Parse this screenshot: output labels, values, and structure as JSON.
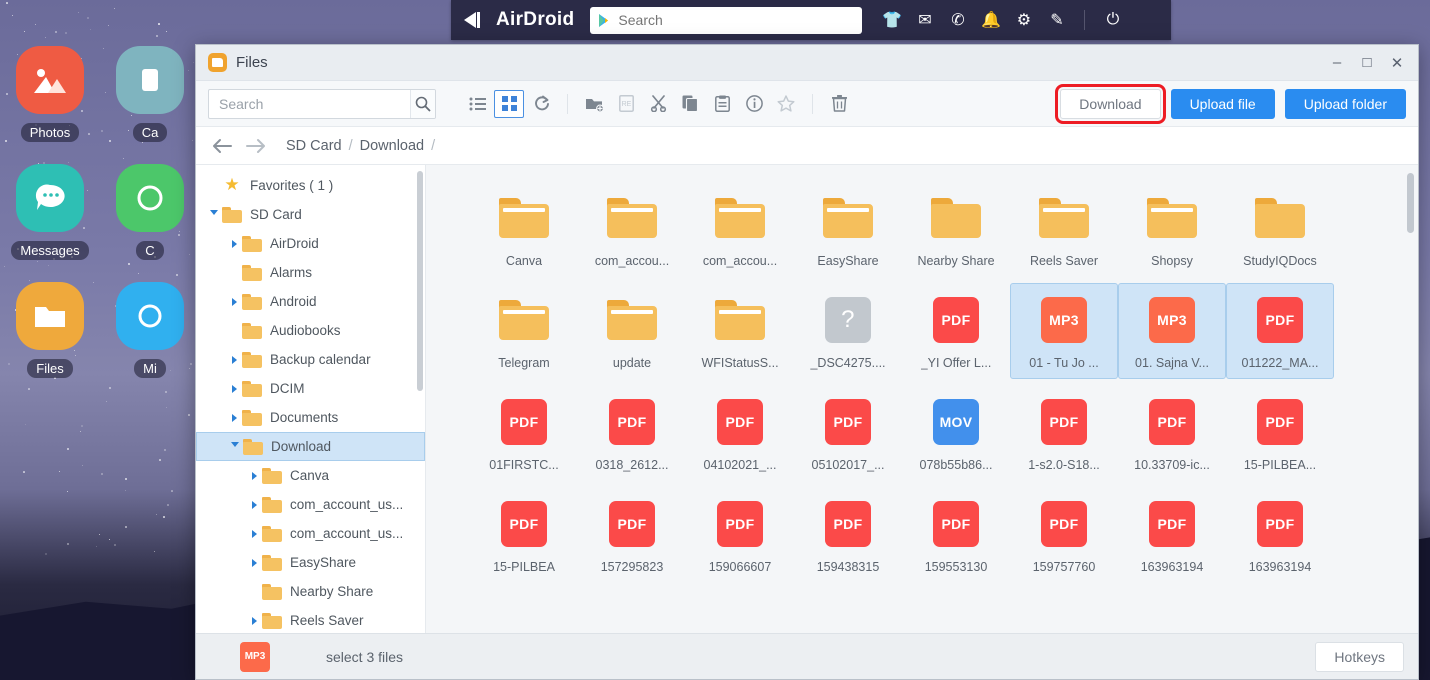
{
  "desktop": {
    "icons": [
      {
        "label": "Photos",
        "icon": "photos-icon",
        "color": "#ef5b43"
      },
      {
        "label": "Ca",
        "icon": "camera-icon",
        "color": "#7fb4bf"
      },
      {
        "label": "Messages",
        "icon": "messages-icon",
        "color": "#2ebfb4"
      },
      {
        "label": "C",
        "icon": "phone-icon",
        "color": "#4cc76a"
      },
      {
        "label": "Files",
        "icon": "files-icon",
        "color": "#efa93c"
      },
      {
        "label": "Mi",
        "icon": "browser-icon",
        "color": "#30b0ef"
      }
    ]
  },
  "topbar": {
    "brand": "AirDroid",
    "back_icon": "back-triangle-icon",
    "search_placeholder": "Search",
    "search_value": "",
    "search_leading_icon": "play-store-icon",
    "icons": [
      {
        "name": "apps-shirt-icon",
        "glyph": "👕"
      },
      {
        "name": "mail-icon",
        "glyph": "✉"
      },
      {
        "name": "phone-icon",
        "glyph": "✆"
      },
      {
        "name": "bell-icon",
        "glyph": "🔔"
      },
      {
        "name": "gear-icon",
        "glyph": "⚙"
      },
      {
        "name": "pencil-icon",
        "glyph": "✎"
      },
      {
        "name": "power-icon",
        "glyph": "⏻"
      }
    ]
  },
  "window": {
    "title": "Files",
    "app_icon": "folder-app-icon",
    "controls": {
      "minimize": "–",
      "maximize": "□",
      "close": "✕"
    }
  },
  "toolbar": {
    "search_placeholder": "Search",
    "search_value": "",
    "search_icon": "magnifier-icon",
    "tools": [
      {
        "name": "list-view-icon",
        "active": false,
        "dim": false
      },
      {
        "name": "grid-view-icon",
        "active": true,
        "dim": false
      },
      {
        "name": "refresh-icon",
        "active": false,
        "dim": false
      },
      {
        "name": "new-folder-icon",
        "active": false,
        "dim": false
      },
      {
        "name": "rename-icon",
        "active": false,
        "dim": true
      },
      {
        "name": "cut-icon",
        "active": false,
        "dim": false
      },
      {
        "name": "copy-icon",
        "active": false,
        "dim": false
      },
      {
        "name": "paste-icon",
        "active": false,
        "dim": false
      },
      {
        "name": "info-icon",
        "active": false,
        "dim": false
      },
      {
        "name": "star-icon",
        "active": false,
        "dim": true
      },
      {
        "name": "delete-icon",
        "active": false,
        "dim": false
      }
    ],
    "download_label": "Download",
    "upload_file_label": "Upload file",
    "upload_folder_label": "Upload folder",
    "highlight_color": "#ed1c24",
    "primary_color": "#2a8cf0"
  },
  "breadcrumb": {
    "back_icon": "arrow-left-icon",
    "forward_icon": "arrow-right-icon",
    "segments": [
      "SD Card",
      "Download"
    ],
    "separator": "/"
  },
  "sidebar": {
    "items": [
      {
        "label": "Favorites ( 1 )",
        "indent": 0,
        "type": "star",
        "caret": "none",
        "selected": false
      },
      {
        "label": "SD Card",
        "indent": 0,
        "type": "folder",
        "caret": "down",
        "selected": false
      },
      {
        "label": "AirDroid",
        "indent": 1,
        "type": "folder",
        "caret": "right",
        "selected": false
      },
      {
        "label": "Alarms",
        "indent": 1,
        "type": "folder",
        "caret": "none",
        "selected": false
      },
      {
        "label": "Android",
        "indent": 1,
        "type": "folder",
        "caret": "right",
        "selected": false
      },
      {
        "label": "Audiobooks",
        "indent": 1,
        "type": "folder",
        "caret": "none",
        "selected": false
      },
      {
        "label": "Backup calendar",
        "indent": 1,
        "type": "folder",
        "caret": "right",
        "selected": false
      },
      {
        "label": "DCIM",
        "indent": 1,
        "type": "folder",
        "caret": "right",
        "selected": false
      },
      {
        "label": "Documents",
        "indent": 1,
        "type": "folder",
        "caret": "right",
        "selected": false
      },
      {
        "label": "Download",
        "indent": 1,
        "type": "folder",
        "caret": "down",
        "selected": true
      },
      {
        "label": "Canva",
        "indent": 2,
        "type": "folder",
        "caret": "right",
        "selected": false
      },
      {
        "label": "com_account_us...",
        "indent": 2,
        "type": "folder",
        "caret": "right",
        "selected": false
      },
      {
        "label": "com_account_us...",
        "indent": 2,
        "type": "folder",
        "caret": "right",
        "selected": false
      },
      {
        "label": "EasyShare",
        "indent": 2,
        "type": "folder",
        "caret": "right",
        "selected": false
      },
      {
        "label": "Nearby Share",
        "indent": 2,
        "type": "folder",
        "caret": "none",
        "selected": false
      },
      {
        "label": "Reels Saver",
        "indent": 2,
        "type": "folder",
        "caret": "right",
        "selected": false
      }
    ]
  },
  "files": [
    {
      "name": "Canva",
      "kind": "folder",
      "lined": true,
      "selected": false
    },
    {
      "name": "com_accou...",
      "kind": "folder",
      "lined": true,
      "selected": false
    },
    {
      "name": "com_accou...",
      "kind": "folder",
      "lined": true,
      "selected": false
    },
    {
      "name": "EasyShare",
      "kind": "folder",
      "lined": true,
      "selected": false
    },
    {
      "name": "Nearby Share",
      "kind": "folder",
      "lined": false,
      "selected": false
    },
    {
      "name": "Reels Saver",
      "kind": "folder",
      "lined": true,
      "selected": false
    },
    {
      "name": "Shopsy",
      "kind": "folder",
      "lined": true,
      "selected": false
    },
    {
      "name": "StudyIQDocs",
      "kind": "folder",
      "lined": false,
      "selected": false
    },
    {
      "name": "Telegram",
      "kind": "folder",
      "lined": true,
      "selected": false
    },
    {
      "name": "update",
      "kind": "folder",
      "lined": true,
      "selected": false
    },
    {
      "name": "WFIStatusS...",
      "kind": "folder",
      "lined": true,
      "selected": false
    },
    {
      "name": "_DSC4275....",
      "kind": "unknown",
      "label": "?",
      "selected": false
    },
    {
      "name": "_YI Offer L...",
      "kind": "pdf",
      "label": "PDF",
      "selected": false
    },
    {
      "name": "01 - Tu Jo ...",
      "kind": "mp3",
      "label": "MP3",
      "selected": true
    },
    {
      "name": "01. Sajna V...",
      "kind": "mp3",
      "label": "MP3",
      "selected": true
    },
    {
      "name": "011222_MA...",
      "kind": "pdf",
      "label": "PDF",
      "selected": true
    },
    {
      "name": "01FIRSTC...",
      "kind": "pdf",
      "label": "PDF",
      "selected": false
    },
    {
      "name": "0318_2612...",
      "kind": "pdf",
      "label": "PDF",
      "selected": false
    },
    {
      "name": "04102021_...",
      "kind": "pdf",
      "label": "PDF",
      "selected": false
    },
    {
      "name": "05102017_...",
      "kind": "pdf",
      "label": "PDF",
      "selected": false
    },
    {
      "name": "078b55b86...",
      "kind": "mov",
      "label": "MOV",
      "selected": false
    },
    {
      "name": "1-s2.0-S18...",
      "kind": "pdf",
      "label": "PDF",
      "selected": false
    },
    {
      "name": "10.33709-ic...",
      "kind": "pdf",
      "label": "PDF",
      "selected": false
    },
    {
      "name": "15-PILBEA...",
      "kind": "pdf",
      "label": "PDF",
      "selected": false
    },
    {
      "name": "15-PILBEA",
      "kind": "pdf",
      "label": "PDF",
      "selected": false
    },
    {
      "name": "157295823",
      "kind": "pdf",
      "label": "PDF",
      "selected": false
    },
    {
      "name": "159066607",
      "kind": "pdf",
      "label": "PDF",
      "selected": false
    },
    {
      "name": "159438315",
      "kind": "pdf",
      "label": "PDF",
      "selected": false
    },
    {
      "name": "159553130",
      "kind": "pdf",
      "label": "PDF",
      "selected": false
    },
    {
      "name": "159757760",
      "kind": "pdf",
      "label": "PDF",
      "selected": false
    },
    {
      "name": "163963194",
      "kind": "pdf",
      "label": "PDF",
      "selected": false
    },
    {
      "name": "163963194",
      "kind": "pdf",
      "label": "PDF",
      "selected": false
    }
  ],
  "statusbar": {
    "badge_label": "MP3",
    "status_text": "select 3 files",
    "hotkeys_label": "Hotkeys"
  }
}
